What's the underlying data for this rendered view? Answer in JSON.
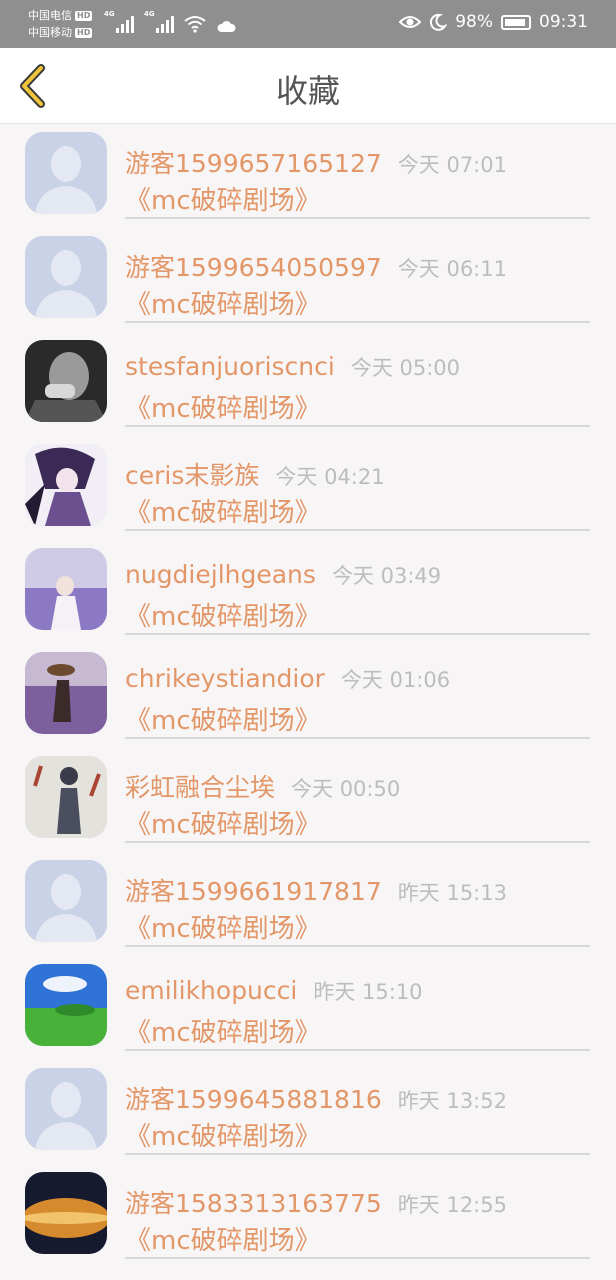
{
  "status": {
    "carrier1": "中国电信",
    "carrier2": "中国移动",
    "hd": "HD",
    "net": "4G",
    "battery": "98%",
    "time": "09:31"
  },
  "header": {
    "title": "收藏"
  },
  "items": [
    {
      "name": "游客1599657165127",
      "time": "今天 07:01",
      "subtitle": "《mc破碎剧场》",
      "avatar": "default-avatar-icon"
    },
    {
      "name": "游客1599654050597",
      "time": "今天 06:11",
      "subtitle": "《mc破碎剧场》",
      "avatar": "default-avatar-icon"
    },
    {
      "name": "stesfanjuoriscnci",
      "time": "今天 05:00",
      "subtitle": "《mc破碎剧场》",
      "avatar": "photo-man"
    },
    {
      "name": "ceris末影族",
      "time": "今天 04:21",
      "subtitle": "《mc破碎剧场》",
      "avatar": "photo-anime"
    },
    {
      "name": "nugdiejlhgeans",
      "time": "今天 03:49",
      "subtitle": "《mc破碎剧场》",
      "avatar": "photo-lavender-girl"
    },
    {
      "name": "chrikeystiandior",
      "time": "今天 01:06",
      "subtitle": "《mc破碎剧场》",
      "avatar": "photo-lavender-field"
    },
    {
      "name": "彩虹融合尘埃",
      "time": "今天 00:50",
      "subtitle": "《mc破碎剧场》",
      "avatar": "photo-drawing"
    },
    {
      "name": "游客1599661917817",
      "time": "昨天 15:13",
      "subtitle": "《mc破碎剧场》",
      "avatar": "default-avatar-icon"
    },
    {
      "name": "emilikhopucci",
      "time": "昨天 15:10",
      "subtitle": "《mc破碎剧场》",
      "avatar": "photo-landscape"
    },
    {
      "name": "游客1599645881816",
      "time": "昨天 13:52",
      "subtitle": "《mc破碎剧场》",
      "avatar": "default-avatar-icon"
    },
    {
      "name": "游客1583313163775",
      "time": "昨天 12:55",
      "subtitle": "《mc破碎剧场》",
      "avatar": "photo-planet"
    }
  ]
}
